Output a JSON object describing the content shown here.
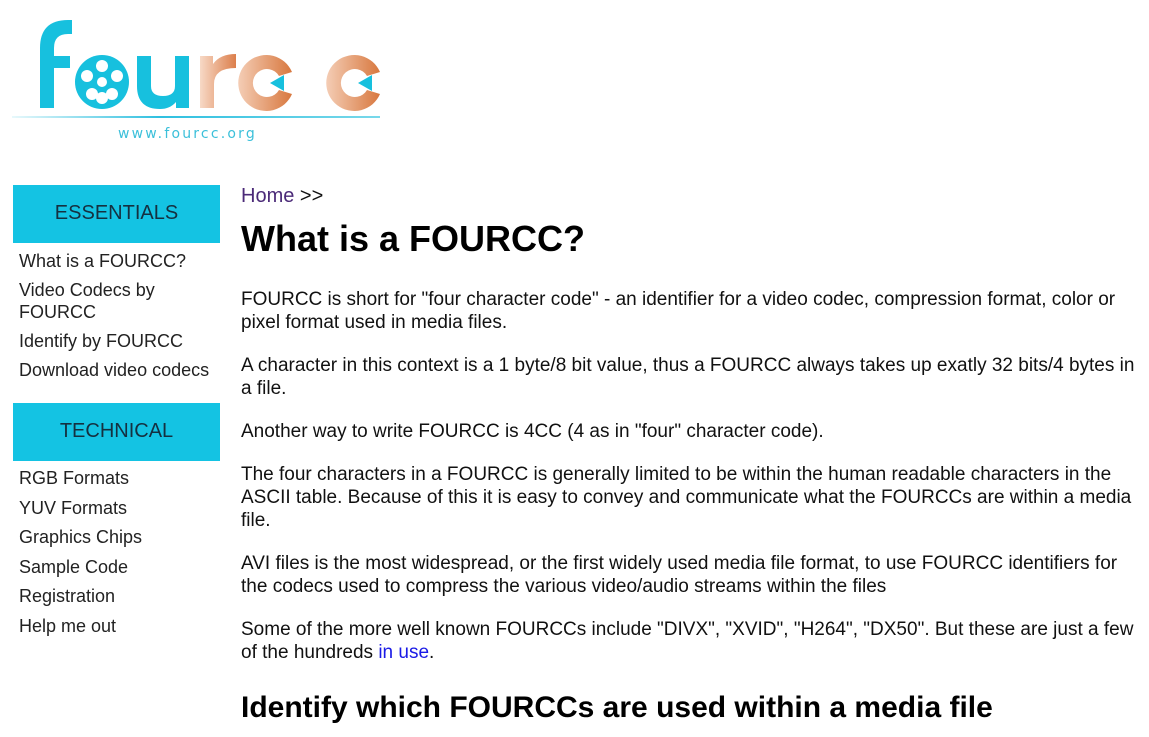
{
  "logo": {
    "wordmark": "fourcc",
    "url_text": "www.fourcc.org"
  },
  "colors": {
    "accent": "#14c3e3",
    "logo_orange": "#e2956a",
    "link": "#1a1ae6",
    "visited_link": "#4b2a78"
  },
  "sidebar": {
    "sections": [
      {
        "header": "ESSENTIALS",
        "items": [
          {
            "label": "What is a FOURCC?"
          },
          {
            "label": "Video Codecs by FOURCC"
          },
          {
            "label": "Identify by FOURCC"
          },
          {
            "label": "Download video codecs"
          }
        ]
      },
      {
        "header": "TECHNICAL",
        "items": [
          {
            "label": "RGB Formats"
          },
          {
            "label": "YUV Formats"
          },
          {
            "label": "Graphics Chips"
          },
          {
            "label": "Sample Code"
          },
          {
            "label": "Registration"
          },
          {
            "label": "Help me out"
          }
        ]
      }
    ]
  },
  "breadcrumb": {
    "home": "Home",
    "separator": " >>"
  },
  "main": {
    "title": "What is a FOURCC?",
    "paragraphs": [
      "FOURCC is short for \"four character code\" - an identifier for a video codec, compression format, color or pixel format used in media files.",
      "A character in this context is a 1 byte/8 bit value, thus a FOURCC always takes up exatly 32 bits/4 bytes in a file.",
      "Another way to write FOURCC is 4CC (4 as in \"four\" character code).",
      "The four characters in a FOURCC is generally limited to be within the human readable characters in the ASCII table. Because of this it is easy to convey and communicate what the FOURCCs are within a media file.",
      "AVI files is the most widespread, or the first widely used media file format, to use FOURCC identifiers for the codecs used to compress the various video/audio streams within the files"
    ],
    "last_paragraph": {
      "before_link": "Some of the more well known FOURCCs include \"DIVX\", \"XVID\", \"H264\", \"DX50\". But these are just a few of the hundreds ",
      "link": "in use",
      "after_link": "."
    },
    "section_heading": "Identify which FOURCCs are used within a media file"
  }
}
